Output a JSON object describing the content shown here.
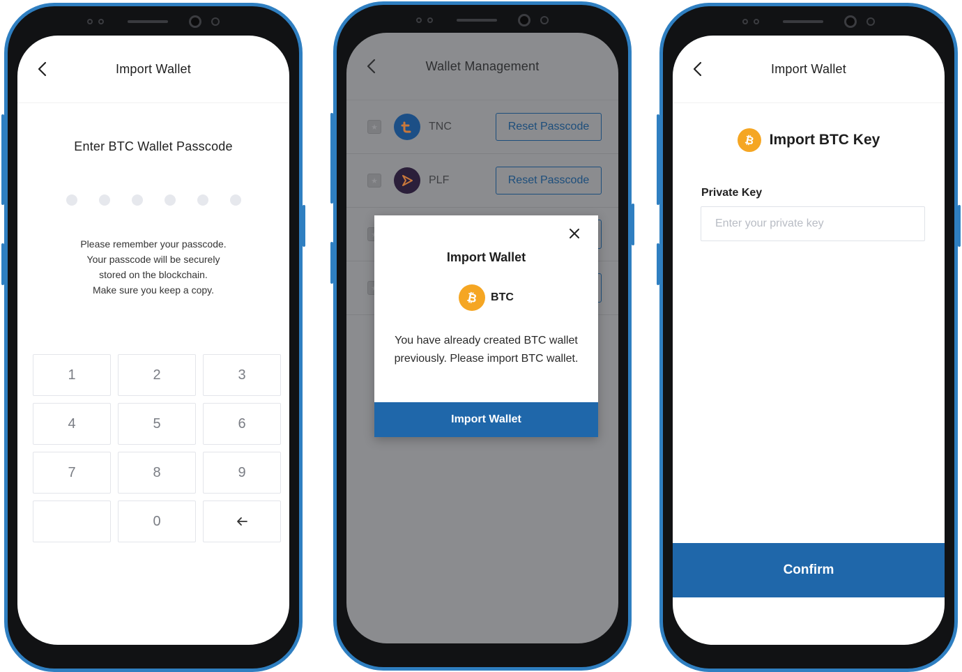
{
  "colors": {
    "frame": "#2f7fc1",
    "primary_button": "#1f67aa",
    "btc_orange": "#f5a623",
    "tnc_blue": "#1c4f86",
    "plf_dark": "#2b1f3a"
  },
  "screen1": {
    "header_title": "Import Wallet",
    "title": "Enter BTC Wallet Passcode",
    "pin_length": 6,
    "notice_lines": [
      "Please remember your passcode.",
      "Your passcode will be securely",
      "stored on the blockchain.",
      "Make sure you keep a copy."
    ],
    "keys": [
      "1",
      "2",
      "3",
      "4",
      "5",
      "6",
      "7",
      "8",
      "9",
      "",
      "0",
      "←"
    ]
  },
  "screen2": {
    "header_title": "Wallet Management",
    "wallets": [
      {
        "name": "TNC",
        "button": "Reset Passcode",
        "icon": "tnc-logo-icon"
      },
      {
        "name": "PLF",
        "button": "Reset Passcode",
        "icon": "plf-logo-icon"
      }
    ],
    "modal": {
      "title": "Import Wallet",
      "coin_label": "BTC",
      "message": "You have already created BTC wallet previously. Please import BTC wallet.",
      "button": "Import Wallet"
    }
  },
  "screen3": {
    "header_title": "Import Wallet",
    "heading": "Import BTC Key",
    "field_label": "Private Key",
    "field_placeholder": "Enter your private key",
    "field_value": "",
    "confirm": "Confirm"
  }
}
